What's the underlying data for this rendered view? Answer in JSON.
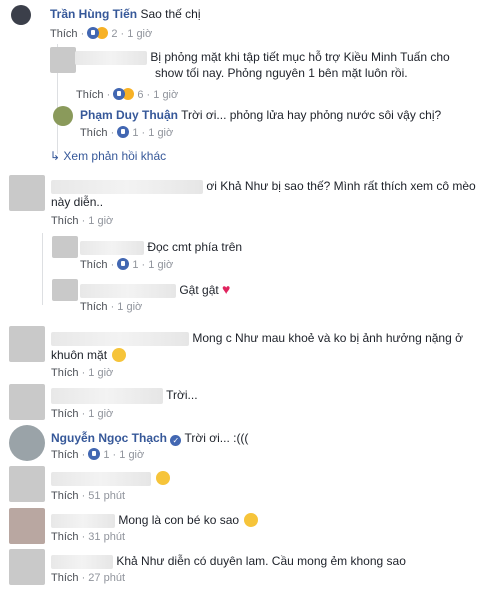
{
  "comments": [
    {
      "name": "Trần Hùng Tiến",
      "text": "Sao thế chị",
      "like": "Thích",
      "reaction_count": "2",
      "time": "1 giờ"
    },
    {
      "name": "",
      "text_line1": "Bị phỏng mặt khi tập tiết mục hỗ trợ Kiều Minh Tuấn cho",
      "text_line2": "show tối nay. Phỏng nguyên 1 bên mặt luôn rồi.",
      "like": "Thích",
      "reaction_count": "6",
      "time": "1 giờ"
    },
    {
      "name": "Phạm Duy Thuận",
      "text": "Trời ơi... phỏng lửa hay phỏng nước sôi vậy chị?",
      "like": "Thích",
      "reaction_count": "1",
      "time": "1 giờ"
    },
    {
      "more_replies": "Xem phản hồi khác"
    },
    {
      "name": "",
      "text_line1": "ơi Khả Như bị sao thế? Mình rất thích xem cô mèo",
      "text_line2": "này diễn..",
      "like": "Thích",
      "time": "1 giờ"
    },
    {
      "name": "",
      "text": "Đọc cmt phía trên",
      "like": "Thích",
      "reaction_count": "1",
      "time": "1 giờ"
    },
    {
      "name": "",
      "text": "Gật gật",
      "like": "Thích",
      "time": "1 giờ"
    },
    {
      "name": "",
      "text_line1": "Mong c Như mau khoẻ và ko bị ảnh hưởng nặng ở",
      "text_line2": "khuôn mặt",
      "like": "Thích",
      "time": "1 giờ"
    },
    {
      "name": "",
      "text": "Trời...",
      "like": "Thích",
      "time": "1 giờ"
    },
    {
      "name": "Nguyễn Ngọc Thạch",
      "text": "Trời ơi... :(((",
      "like": "Thích",
      "reaction_count": "1",
      "time": "1 giờ"
    },
    {
      "name": "",
      "text": "",
      "like": "Thích",
      "time": "51 phút"
    },
    {
      "name": "",
      "text": "Mong là con bé ko sao",
      "like": "Thích",
      "time": "31 phút"
    },
    {
      "name": "",
      "text": "Khả Như diễn có duyên lam. Cầu mong ẻm khong sao",
      "like": "Thích",
      "time": "27 phút"
    }
  ],
  "colors": {
    "name": "#365899",
    "meta": "#90949c",
    "like_blue": "#4267b2"
  }
}
